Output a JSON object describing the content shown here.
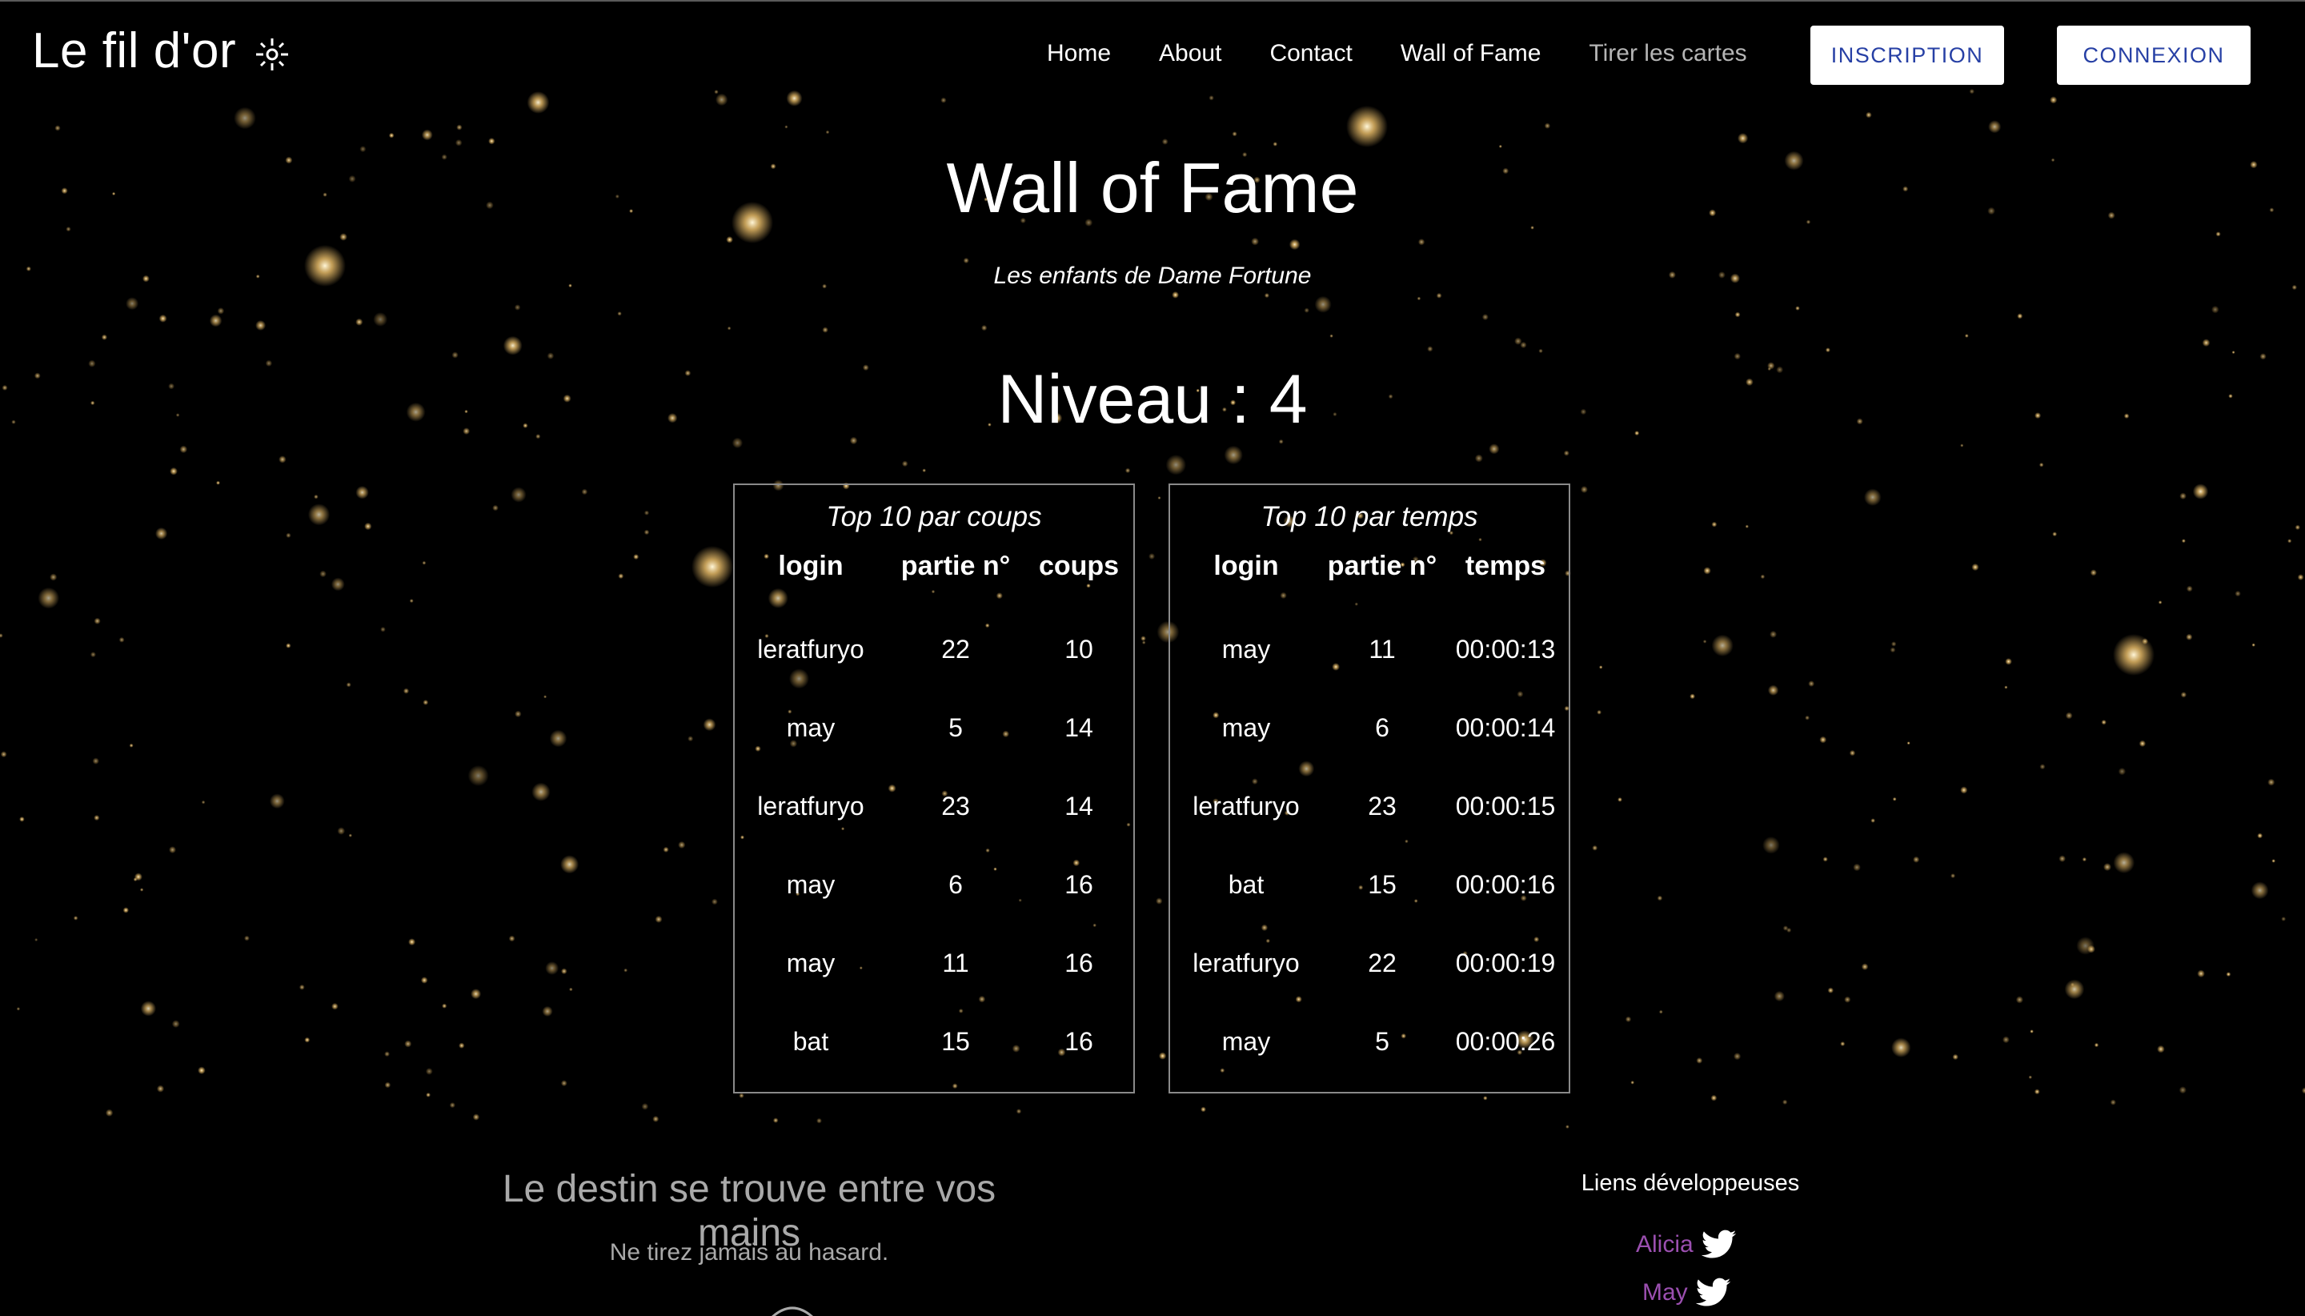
{
  "brand": {
    "name": "Le fil d'or",
    "icon": "sparkle-icon"
  },
  "nav": {
    "links": [
      "Home",
      "About",
      "Contact",
      "Wall of Fame",
      "Tirer les cartes"
    ],
    "inscription": "INSCRIPTION",
    "connexion": "CONNEXION",
    "button_color": "#2740a5"
  },
  "page": {
    "title": "Wall of Fame",
    "subtitle": "Les enfants de Dame Fortune",
    "level": "Niveau : 4"
  },
  "tables": {
    "coups": {
      "caption": "Top 10 par coups",
      "headers": [
        "login",
        "partie n°",
        "coups"
      ],
      "rows": [
        [
          "leratfuryo",
          "22",
          "10"
        ],
        [
          "may",
          "5",
          "14"
        ],
        [
          "leratfuryo",
          "23",
          "14"
        ],
        [
          "may",
          "6",
          "16"
        ],
        [
          "may",
          "11",
          "16"
        ],
        [
          "bat",
          "15",
          "16"
        ]
      ]
    },
    "temps": {
      "caption": "Top 10 par temps",
      "headers": [
        "login",
        "partie n°",
        "temps"
      ],
      "rows": [
        [
          "may",
          "11",
          "00:00:13"
        ],
        [
          "may",
          "6",
          "00:00:14"
        ],
        [
          "leratfuryo",
          "23",
          "00:00:15"
        ],
        [
          "bat",
          "15",
          "00:00:16"
        ],
        [
          "leratfuryo",
          "22",
          "00:00:19"
        ],
        [
          "may",
          "5",
          "00:00:26"
        ]
      ]
    }
  },
  "footer": {
    "title": "Le destin se trouve entre vos mains",
    "text": "Ne tirez jamais au hasard.",
    "dev_title": "Liens développeuses",
    "devs": [
      {
        "name": "Alicia",
        "icon": "twitter-icon"
      },
      {
        "name": "May",
        "icon": "twitter-icon"
      }
    ],
    "link_color": "#9b4fb0"
  },
  "colors": {
    "background": "#000000",
    "star": "#f2c46d",
    "footer_text": "#a9a9a9"
  }
}
